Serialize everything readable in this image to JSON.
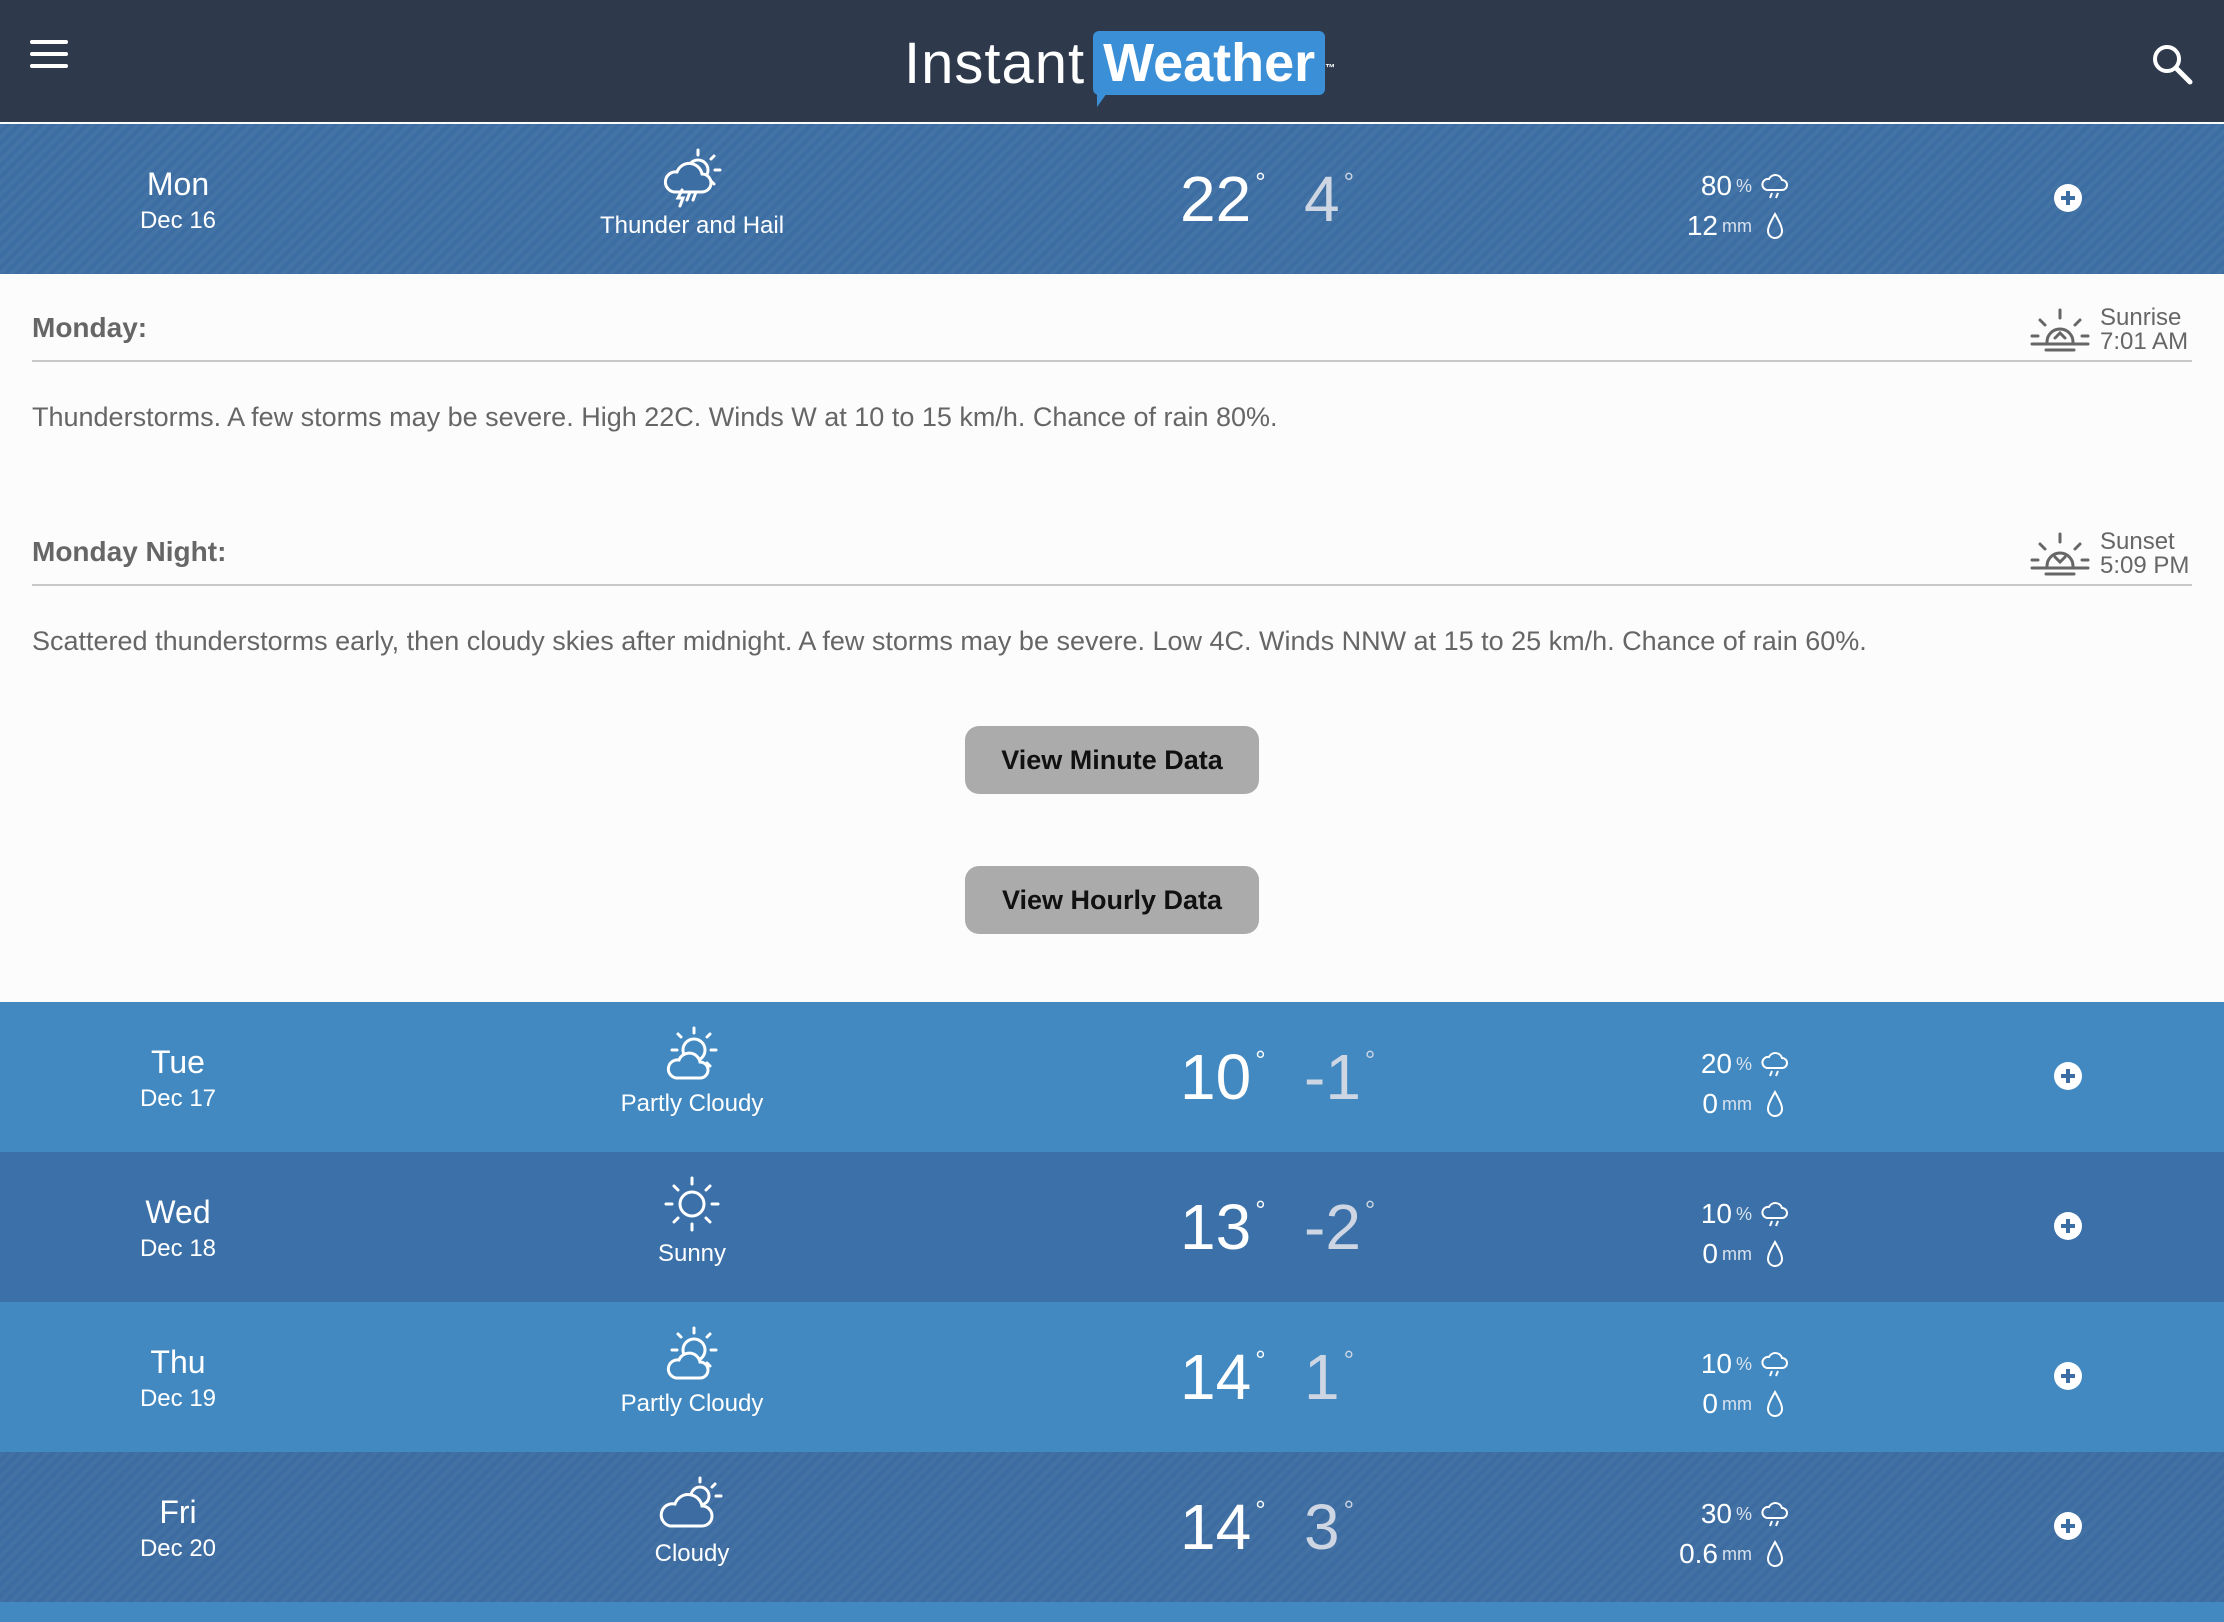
{
  "app": {
    "logo_word1": "Instant",
    "logo_word2": "Weather",
    "logo_tm": "™"
  },
  "icons": {
    "menu": "hamburger-menu-icon",
    "search": "search-icon",
    "expand": "plus-circle-icon",
    "precip_chance": "rain-cloud-icon",
    "precip_amount": "raindrop-icon",
    "sunrise": "sunrise-icon",
    "sunset": "sunset-icon"
  },
  "colors": {
    "header": "#2e3a4c",
    "accent": "#3b8fd6",
    "row_dark": "#3d6ea3",
    "row_light": "#4289c1"
  },
  "units": {
    "percent": "%",
    "mm": "mm",
    "deg": "°"
  },
  "days": [
    {
      "day": "Mon",
      "date": "Dec 16",
      "condition": "Thunder and Hail",
      "icon": "thunder-hail-icon",
      "high": "22",
      "low": "4",
      "chance": "80",
      "amount": "12"
    },
    {
      "day": "Tue",
      "date": "Dec 17",
      "condition": "Partly Cloudy",
      "icon": "partly-cloudy-icon",
      "high": "10",
      "low": "-1",
      "chance": "20",
      "amount": "0"
    },
    {
      "day": "Wed",
      "date": "Dec 18",
      "condition": "Sunny",
      "icon": "sunny-icon",
      "high": "13",
      "low": "-2",
      "chance": "10",
      "amount": "0"
    },
    {
      "day": "Thu",
      "date": "Dec 19",
      "condition": "Partly Cloudy",
      "icon": "partly-cloudy-icon",
      "high": "14",
      "low": "1",
      "chance": "10",
      "amount": "0"
    },
    {
      "day": "Fri",
      "date": "Dec 20",
      "condition": "Cloudy",
      "icon": "cloudy-icon",
      "high": "14",
      "low": "3",
      "chance": "30",
      "amount": "0.6"
    }
  ],
  "detail": {
    "day_title": "Monday:",
    "sunrise_label": "Sunrise",
    "sunrise_time": "7:01 AM",
    "day_text": "Thunderstorms. A few storms may be severe. High 22C. Winds W at 10 to 15 km/h. Chance of rain 80%.",
    "night_title": "Monday Night:",
    "sunset_label": "Sunset",
    "sunset_time": "5:09 PM",
    "night_text": "Scattered thunderstorms early, then cloudy skies after midnight. A few storms may be severe. Low 4C. Winds NNW at 15 to 25 km/h. Chance of rain 60%.",
    "minute_button": "View Minute Data",
    "hourly_button": "View Hourly Data"
  }
}
